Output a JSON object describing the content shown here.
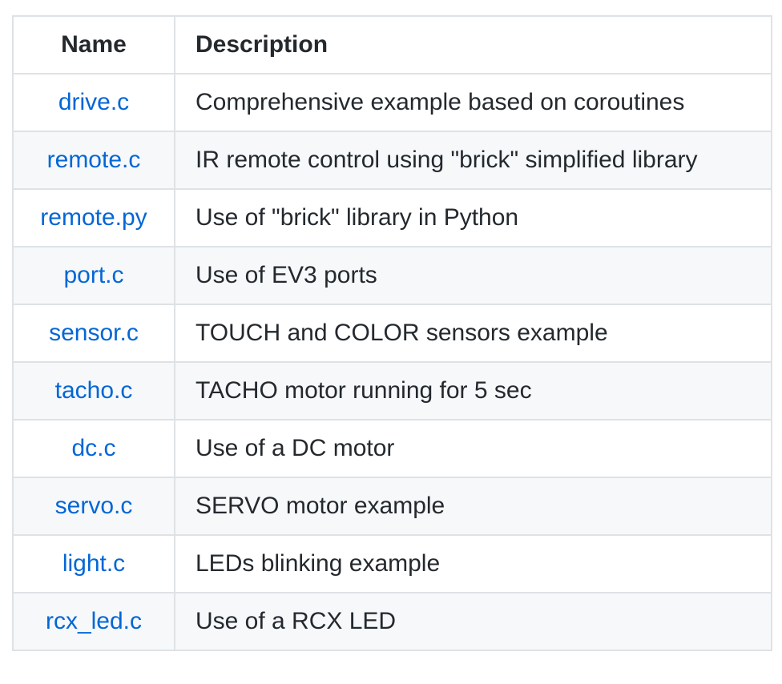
{
  "table": {
    "headers": {
      "name": "Name",
      "description": "Description"
    },
    "rows": [
      {
        "name": "drive.c",
        "description": "Comprehensive example based on coroutines"
      },
      {
        "name": "remote.c",
        "description": "IR remote control using \"brick\" simplified library"
      },
      {
        "name": "remote.py",
        "description": "Use of \"brick\" library in Python"
      },
      {
        "name": "port.c",
        "description": "Use of EV3 ports"
      },
      {
        "name": "sensor.c",
        "description": "TOUCH and COLOR sensors example"
      },
      {
        "name": "tacho.c",
        "description": "TACHO motor running for 5 sec"
      },
      {
        "name": "dc.c",
        "description": "Use of a DC motor"
      },
      {
        "name": "servo.c",
        "description": "SERVO motor example"
      },
      {
        "name": "light.c",
        "description": "LEDs blinking example"
      },
      {
        "name": "rcx_led.c",
        "description": "Use of a RCX LED"
      }
    ]
  },
  "colors": {
    "link": "#0366d6",
    "text": "#24292e",
    "border": "#dfe2e5",
    "stripe": "#f6f8fa"
  }
}
